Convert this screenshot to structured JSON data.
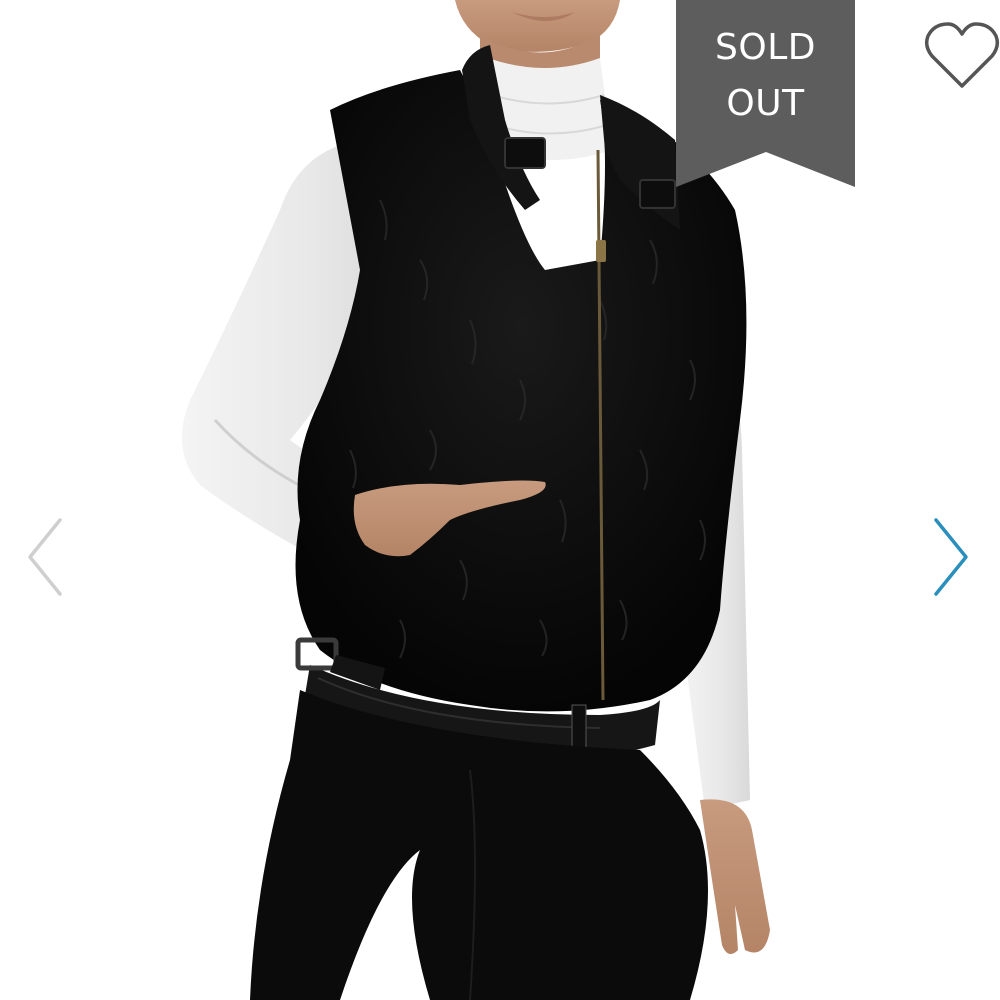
{
  "badge": {
    "line1": "SOLD",
    "line2": "OUT",
    "color": "#5d5d5d"
  },
  "icons": {
    "favorite": "heart-outline-icon",
    "previous": "chevron-left-icon",
    "next": "chevron-right-icon"
  },
  "colors": {
    "next_arrow": "#2a8fbd",
    "prev_arrow": "#cfcfcf",
    "heart_outline": "#555555"
  }
}
